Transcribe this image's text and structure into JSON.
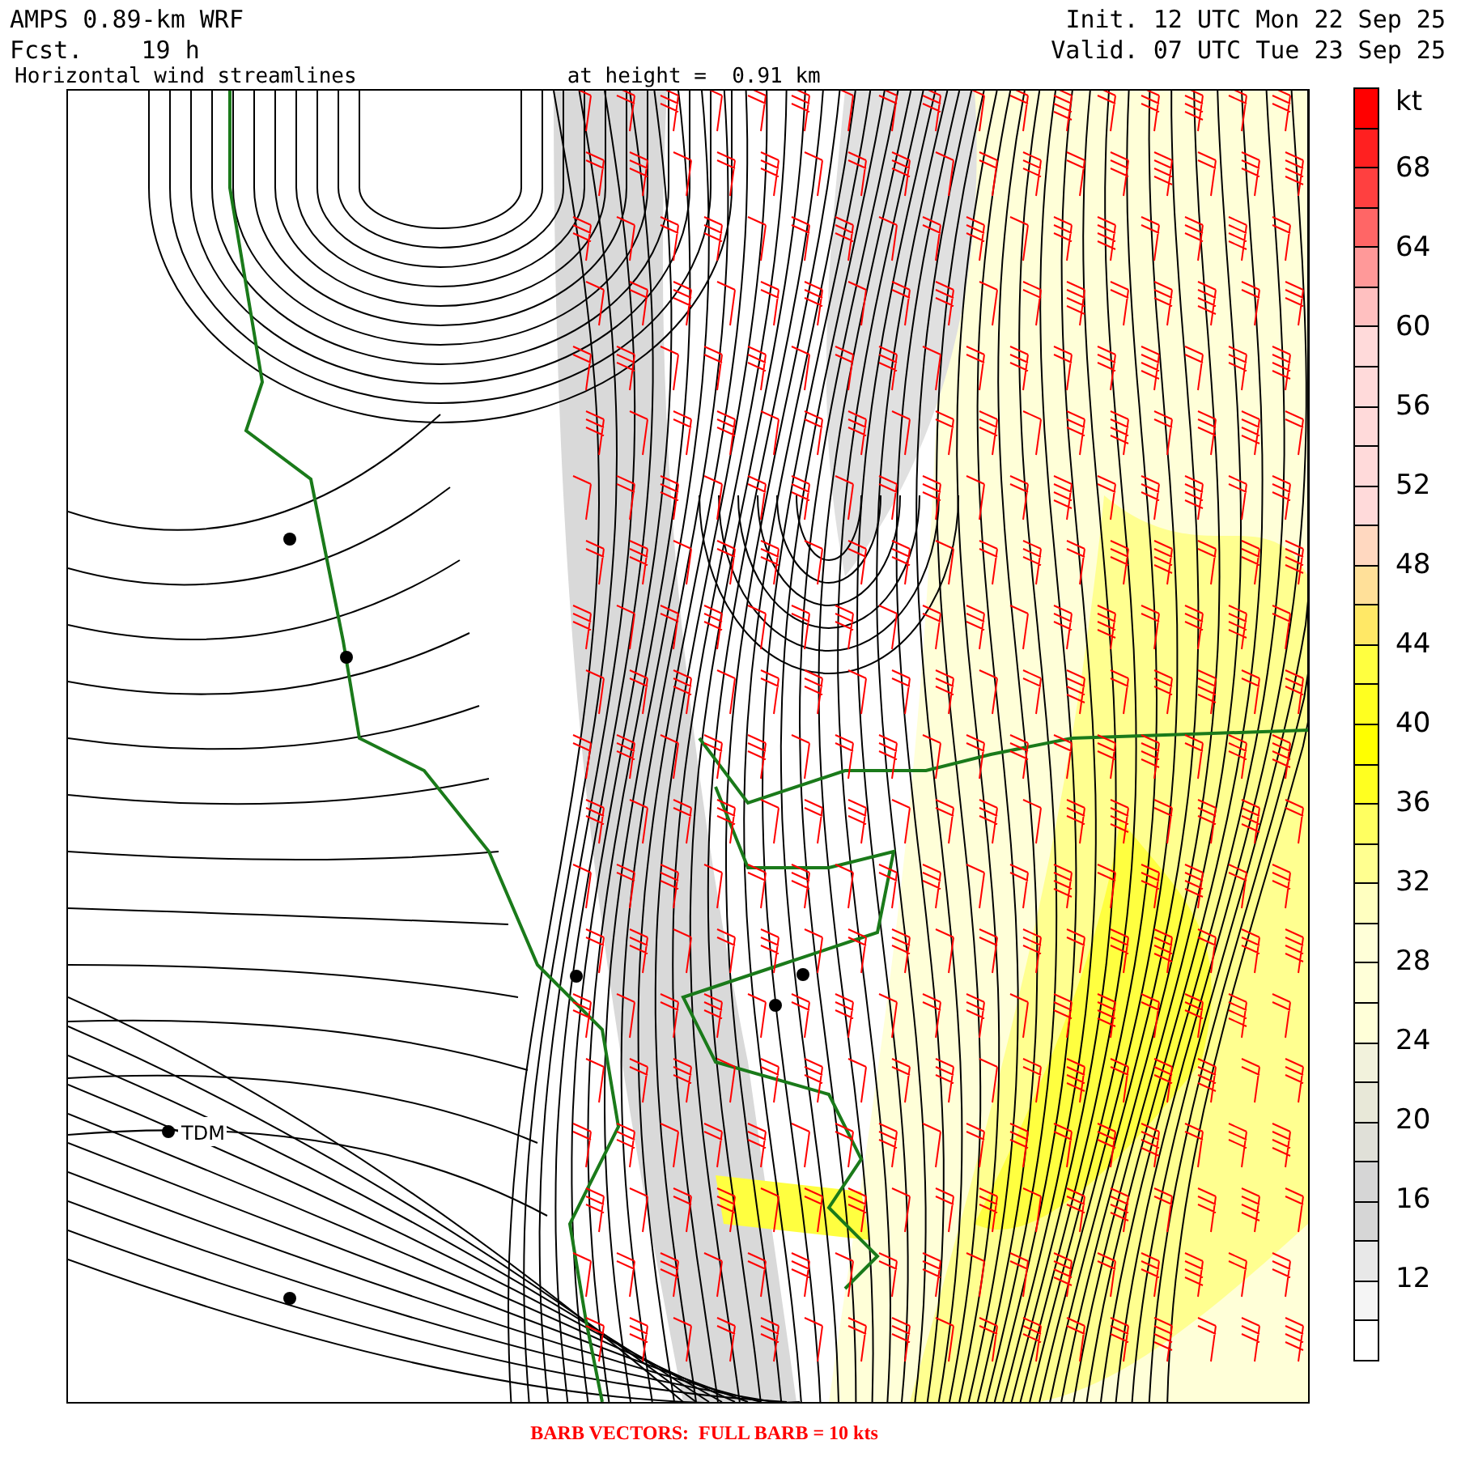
{
  "header": {
    "model": "AMPS 0.89-km WRF",
    "forecast": "Fcst.    19 h",
    "init": "Init. 12 UTC Mon 22 Sep 25",
    "valid": "Valid. 07 UTC Tue 23 Sep 25",
    "field": "Horizontal wind streamlines",
    "height": "at height =  0.91 km"
  },
  "map": {
    "stations": [
      {
        "label": "TDM"
      }
    ]
  },
  "colorbar": {
    "unit": "kt",
    "labels": [
      "68",
      "64",
      "60",
      "56",
      "52",
      "48",
      "44",
      "40",
      "36",
      "32",
      "28",
      "24",
      "20",
      "16",
      "12"
    ],
    "boxes": [
      {
        "color": "#ff0000"
      },
      {
        "color": "#ff2020"
      },
      {
        "color": "#ff4040"
      },
      {
        "color": "#ff6666"
      },
      {
        "color": "#ff9999"
      },
      {
        "color": "#ffc0c0"
      },
      {
        "color": "#ffdada"
      },
      {
        "color": "#ffdada"
      },
      {
        "color": "#ffdada"
      },
      {
        "color": "#ffdada"
      },
      {
        "color": "#ffdada"
      },
      {
        "color": "#ffd8c0"
      },
      {
        "color": "#ffe099"
      },
      {
        "color": "#ffe866"
      },
      {
        "color": "#ffff40"
      },
      {
        "color": "#ffff20"
      },
      {
        "color": "#ffff00"
      },
      {
        "color": "#ffff20"
      },
      {
        "color": "#ffff60"
      },
      {
        "color": "#ffff90"
      },
      {
        "color": "#ffffc0"
      },
      {
        "color": "#ffffd8"
      },
      {
        "color": "#ffffd8"
      },
      {
        "color": "#ffffd8"
      },
      {
        "color": "#f2f2dc"
      },
      {
        "color": "#e8e8d8"
      },
      {
        "color": "#e0e0d8"
      },
      {
        "color": "#d6d6d6"
      },
      {
        "color": "#d6d6d6"
      },
      {
        "color": "#e8e8e8"
      },
      {
        "color": "#f5f5f5"
      },
      {
        "color": "#ffffff"
      }
    ]
  },
  "caption": "BARB VECTORS:  FULL BARB = 10 kts"
}
